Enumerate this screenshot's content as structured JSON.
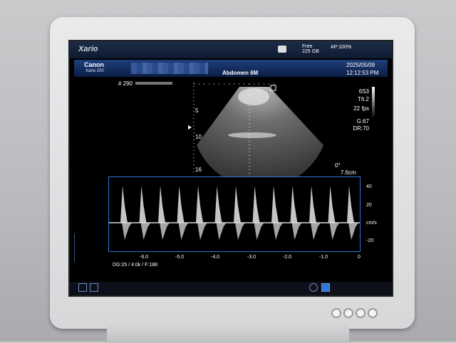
{
  "top": {
    "brand": "Xario",
    "disk_line1": "Free",
    "disk_line2": "225 GB",
    "ap_status": "AP:100%"
  },
  "info": {
    "logo": "Canon",
    "model": "Xario 200",
    "study": "Abdomen 6M",
    "date": "2025/05/09",
    "time": "12:12:53 PM"
  },
  "image": {
    "frame": "# 290",
    "params": [
      "6S3",
      "T6.2",
      "22 fps",
      "G:67",
      "DR:70"
    ],
    "depth_ticks": [
      "5",
      "10",
      "16"
    ],
    "angle": "0°",
    "depth_cm": "7.6cm"
  },
  "doppler": {
    "scale": [
      "40",
      "20",
      "cm/s",
      "-20"
    ],
    "time_axis": [
      "-6.0",
      "-5.0",
      "-4.0",
      "-3.0",
      "-2.0",
      "-1.0",
      "0"
    ],
    "settings": "DG:25  / 4.0k   / F:188"
  },
  "colors": {
    "accent": "#2f77d8",
    "bar": "#0b1d45"
  }
}
